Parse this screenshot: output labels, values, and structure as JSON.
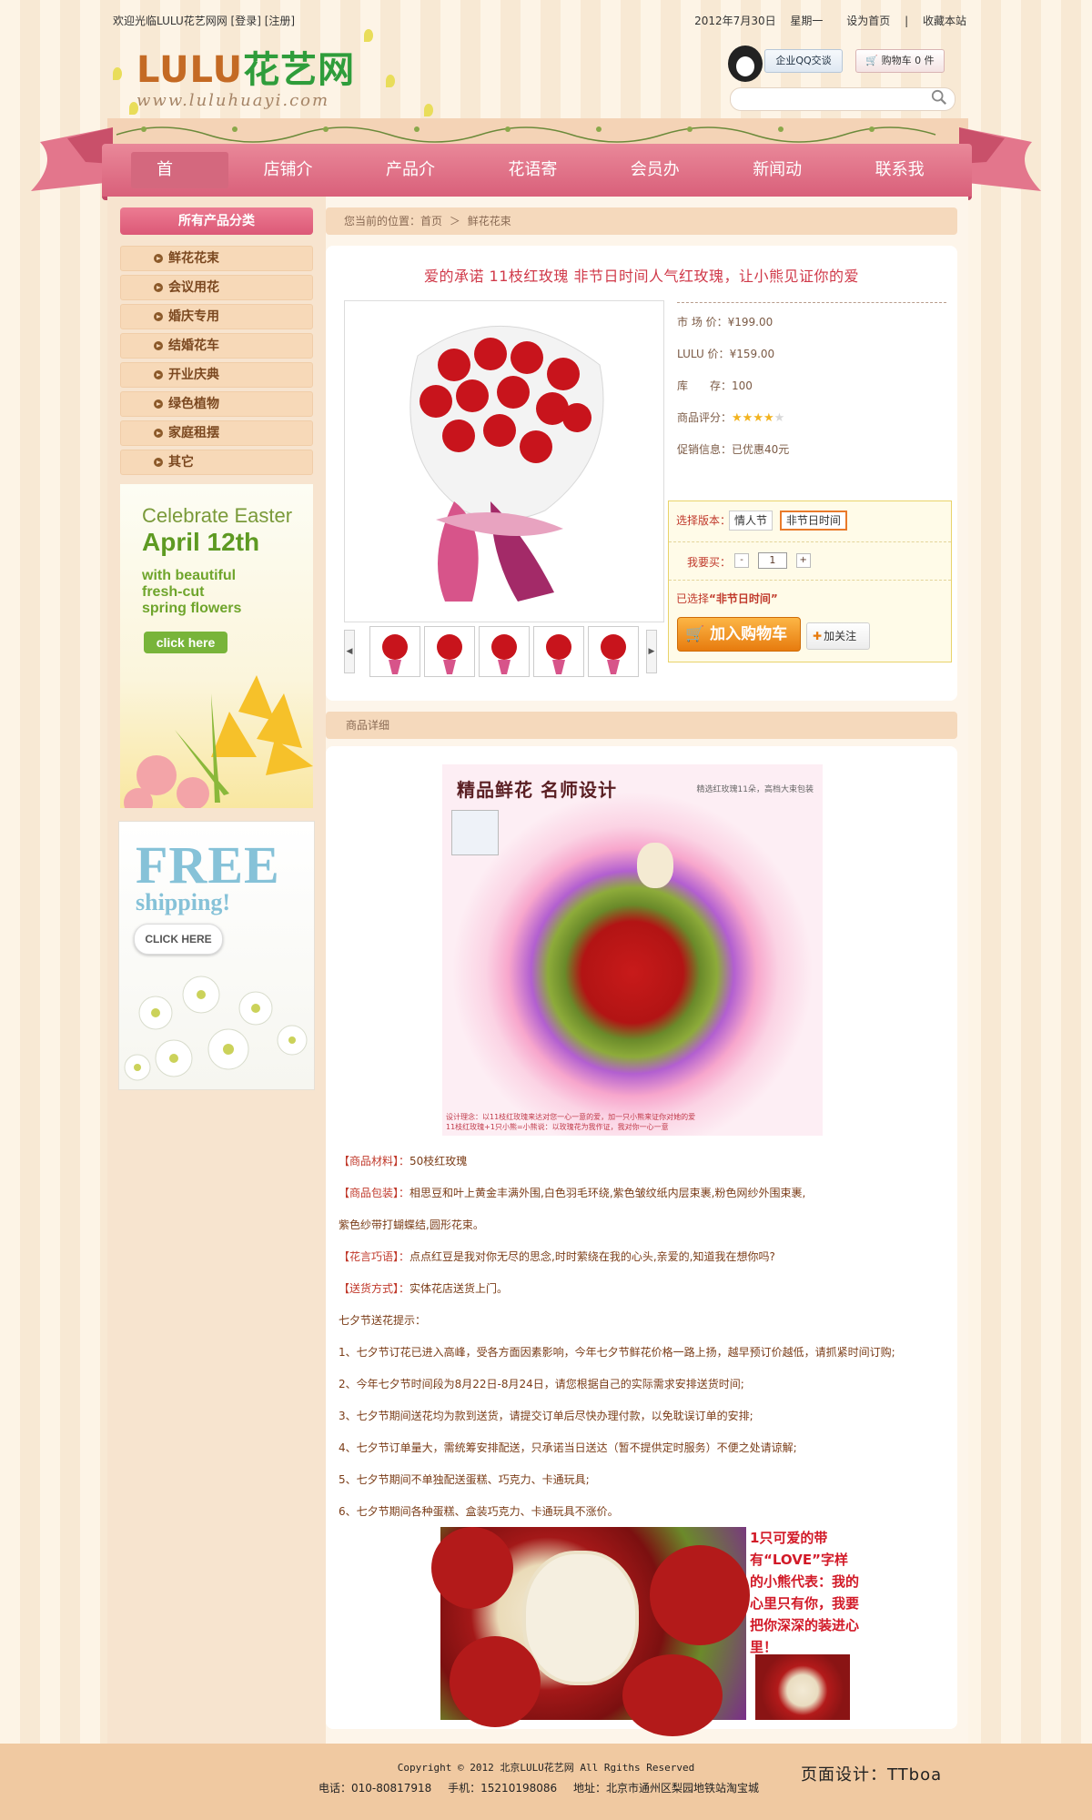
{
  "header": {
    "welcome": "欢迎光临LULU花艺网网 [登录] [注册]",
    "date": "2012年7月30日",
    "weekday": "星期一",
    "set_home": "设为首页",
    "separator": "|",
    "bookmark": "收藏本站",
    "logo_brand": "LULU",
    "logo_cn": "花艺网",
    "logo_url": "www.luluhuayi.com",
    "qq_button": "企业QQ交谈",
    "cart_button": "购物车 0 件",
    "search_placeholder": ""
  },
  "nav": {
    "items": [
      {
        "label": "首　页",
        "active": true
      },
      {
        "label": "店铺介绍"
      },
      {
        "label": "产品介绍"
      },
      {
        "label": "花语寄语"
      },
      {
        "label": "会员办理"
      },
      {
        "label": "新闻动态"
      },
      {
        "label": "联系我们"
      }
    ]
  },
  "sidebar": {
    "title": "所有产品分类",
    "categories": [
      "鲜花花束",
      "会议用花",
      "婚庆专用",
      "结婚花车",
      "开业庆典",
      "绿色植物",
      "家庭租摆",
      "其它"
    ],
    "banner1": {
      "line1": "Celebrate Easter",
      "line2": "April 12th",
      "line3": "with beautiful",
      "line4": "fresh-cut",
      "line5": "spring flowers",
      "button": "click here"
    },
    "banner2": {
      "line1": "FREE",
      "line2": "shipping!",
      "button": "CLICK HERE"
    }
  },
  "breadcrumb": {
    "prefix": "您当前的位置：",
    "home": "首页",
    "arrow": "＞",
    "current": "鲜花花束"
  },
  "product": {
    "title": "爱的承诺 11枝红玫瑰 非节日时间人气红玫瑰，让小熊见证你的爱",
    "market_price_label": "市 场 价：",
    "market_price": "¥199.00",
    "lulu_price_label": "LULU 价：",
    "lulu_price": "¥159.00",
    "stock_label": "库　　存：",
    "stock": "100",
    "rating_label": "商品评分：",
    "rating": 4,
    "rating_max": 5,
    "promo_label": "促销信息：",
    "promo": "已优惠40元",
    "version_label": "选择版本：",
    "versions": [
      "情人节",
      "非节日时间"
    ],
    "selected_version_index": 1,
    "qty_label": "我要买：",
    "qty_minus": "-",
    "qty": "1",
    "qty_plus": "+",
    "selected_text": "已选择",
    "selected_value": "“非节日时间”",
    "add_to_cart": "加入购物车",
    "follow": "加关注",
    "thumb_prev": "◀",
    "thumb_next": "▶"
  },
  "detail": {
    "header": "商品详细",
    "img1_heading": "精品鲜花 名师设计",
    "img1_sub": "精选红玫瑰11朵，高档大束包装",
    "img1_caption1": "设计理念：以11枝红玫瑰来达对您一心一意的爱，加一只小熊来证你对她的爱",
    "img1_caption2": "11枝红玫瑰+1只小熊=小熊说：以玫瑰花为我作证，我对你一心一意",
    "lines": [
      {
        "key": "【商品材料】：",
        "text": "50枝红玫瑰"
      },
      {
        "key": "【商品包装】：",
        "text": "相思豆和叶上黄金丰满外围,白色羽毛环绕,紫色皱纹纸内层束裹,粉色网纱外围束裹,"
      },
      {
        "key": "",
        "text": "紫色纱带打蝴蝶结,圆形花束。"
      },
      {
        "key": "【花言巧语】：",
        "text": "点点红豆是我对你无尽的思念,时时萦绕在我的心头,亲爱的,知道我在想你吗?"
      },
      {
        "key": "【送货方式】：",
        "text": "实体花店送货上门。"
      },
      {
        "key": "",
        "text": "七夕节送花提示："
      },
      {
        "key": "",
        "text": "1、七夕节订花已进入高峰，受各方面因素影响，今年七夕节鲜花价格一路上扬，越早预订价越低，请抓紧时间订购;"
      },
      {
        "key": "",
        "text": "2、今年七夕节时间段为8月22日-8月24日，请您根据自己的实际需求安排送货时间;"
      },
      {
        "key": "",
        "text": "3、七夕节期间送花均为款到送货，请提交订单后尽快办理付款，以免耽误订单的安排;"
      },
      {
        "key": "",
        "text": "4、七夕节订单量大，需统筹安排配送，只承诺当日送达（暂不提供定时服务）不便之处请谅解;"
      },
      {
        "key": "",
        "text": "5、七夕节期间不单独配送蛋糕、巧克力、卡通玩具;"
      },
      {
        "key": "",
        "text": "6、七夕节期间各种蛋糕、盒装巧克力、卡通玩具不涨价。"
      }
    ],
    "img2_text": "1只可爱的带有“LOVE”字样的小熊代表：我的心里只有你，我要把你深深的装进心里！"
  },
  "footer": {
    "copyright": "Copyright © 2012 北京LULU花艺网 All Rgiths Reserved",
    "phone": "电话：010-80817918",
    "mobile": "手机：15210198086",
    "address": "地址：北京市通州区梨园地铁站淘宝城",
    "design": "页面设计：TTboa"
  },
  "colors": {
    "accent": "#d9607a",
    "brand_orange": "#c46a24",
    "brand_green": "#2f9d3b",
    "price_text": "#7b5a45",
    "title_red": "#d03a4a"
  }
}
